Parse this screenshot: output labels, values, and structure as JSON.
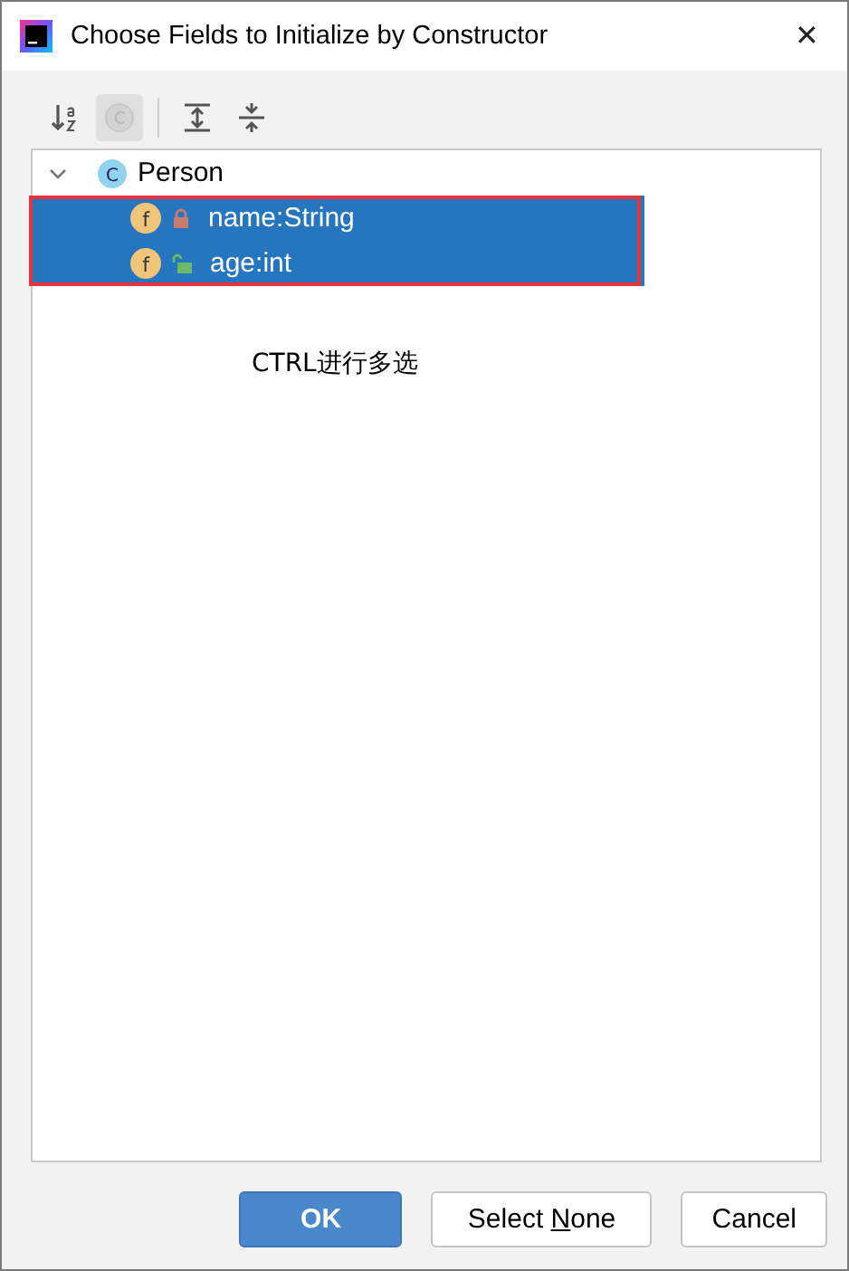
{
  "window": {
    "title": "Choose Fields to Initialize by Constructor",
    "close": "✕"
  },
  "toolbar": [
    {
      "kind": "sort",
      "selected": false,
      "disabled": false
    },
    {
      "kind": "class",
      "selected": true,
      "disabled": true
    },
    {
      "kind": "separator"
    },
    {
      "kind": "expand",
      "selected": false,
      "disabled": false
    },
    {
      "kind": "collapse",
      "selected": false,
      "disabled": false
    }
  ],
  "tree": {
    "label": "Person",
    "icon": "C",
    "expanded": true,
    "outlined_children": true,
    "children": [
      {
        "label": "name:String",
        "icon": "f",
        "locked": true,
        "selected": true
      },
      {
        "label": "age:int",
        "icon": "f",
        "locked": false,
        "selected": true
      }
    ]
  },
  "note": "CTRL进行多选",
  "buttons": [
    {
      "parts": [
        "OK"
      ],
      "default": true
    },
    {
      "parts": [
        "Select ",
        "N",
        "one"
      ],
      "default": false
    },
    {
      "parts": [
        "Cancel"
      ],
      "default": false
    }
  ]
}
